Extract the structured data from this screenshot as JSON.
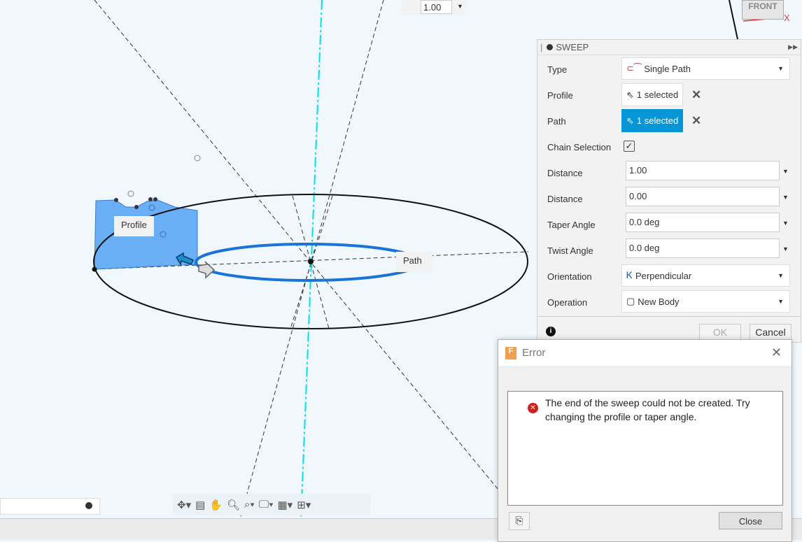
{
  "viewport": {
    "top_value": "1.00",
    "viewcube_face": "FRONT",
    "viewcube_axis": "X",
    "profile_label": "Profile",
    "path_label": "Path"
  },
  "sweep": {
    "title": "SWEEP",
    "type": {
      "label": "Type",
      "value": "Single Path"
    },
    "profile": {
      "label": "Profile",
      "value": "1 selected"
    },
    "path": {
      "label": "Path",
      "value": "1 selected"
    },
    "chain": {
      "label": "Chain Selection",
      "checked": true,
      "mark": "✓"
    },
    "distance1": {
      "label": "Distance",
      "value": "1.00"
    },
    "distance2": {
      "label": "Distance",
      "value": "0.00"
    },
    "taper": {
      "label": "Taper Angle",
      "value": "0.0 deg"
    },
    "twist": {
      "label": "Twist Angle",
      "value": "0.0 deg"
    },
    "orientation": {
      "label": "Orientation",
      "value": "Perpendicular"
    },
    "operation": {
      "label": "Operation",
      "value": "New Body"
    },
    "ok": "OK",
    "cancel": "Cancel"
  },
  "error": {
    "title": "Error",
    "message": "The end of the sweep could not be created. Try changing the profile or taper angle.",
    "close": "Close"
  },
  "colors": {
    "accent": "#0696d7",
    "profile_fill": "#6aaef5",
    "path": "#1a73d9",
    "axis": "#00e0e8"
  }
}
